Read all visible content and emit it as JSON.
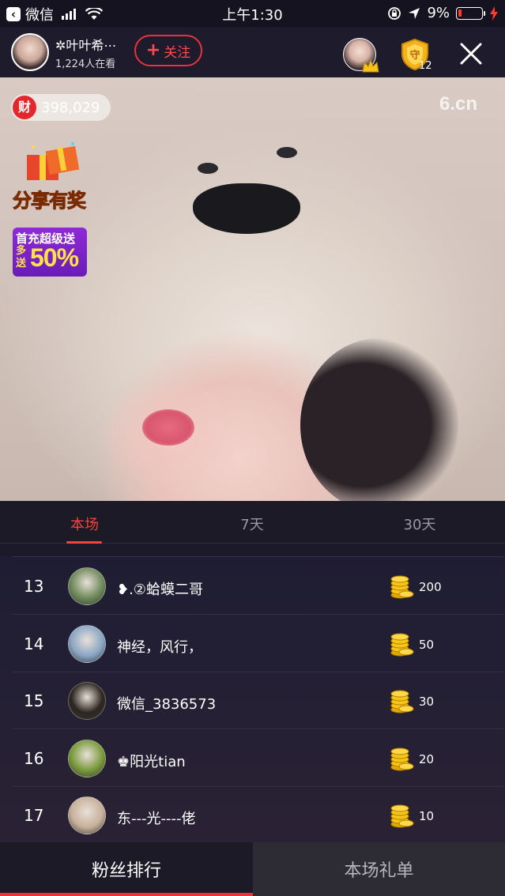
{
  "status_bar": {
    "back_app": "微信",
    "time": "上午1:30",
    "battery_percent": "9%"
  },
  "header": {
    "host_name": "✲叶叶希⋯",
    "viewer_count": "1,224人在看",
    "follow_label": "关注",
    "guard_count": "12"
  },
  "video": {
    "wealth_icon_label": "财",
    "wealth_value": "398,029",
    "watermark": "6.cn",
    "share_reward": "分享有奖",
    "promo_line1": "首充超级送",
    "promo_line2": "多送",
    "promo_percent": "50%"
  },
  "tabs": [
    {
      "label": "本场",
      "active": true
    },
    {
      "label": "7天",
      "active": false
    },
    {
      "label": "30天",
      "active": false
    }
  ],
  "ranking": [
    {
      "rank": "13",
      "name": "❥.②蛤蟆二哥",
      "coins": "200",
      "avatar_color": "#6f8a5a"
    },
    {
      "rank": "14",
      "name": "神经，风行，",
      "coins": "50",
      "avatar_color": "#8aa6c4"
    },
    {
      "rank": "15",
      "name": "微信_3836573",
      "coins": "30",
      "avatar_color": "#2c2620"
    },
    {
      "rank": "16",
      "name": "♚阳光tian",
      "coins": "20",
      "avatar_color": "#7a9a3c"
    },
    {
      "rank": "17",
      "name": "东---光----佬",
      "coins": "10",
      "avatar_color": "#c7b09a"
    }
  ],
  "bottom_tabs": {
    "fans_rank": "粉丝排行",
    "gift_list": "本场礼单"
  },
  "colors": {
    "accent_red": "#e8333a",
    "coin_gold": "#f5c518",
    "panel_bg": "#1c1a26"
  }
}
